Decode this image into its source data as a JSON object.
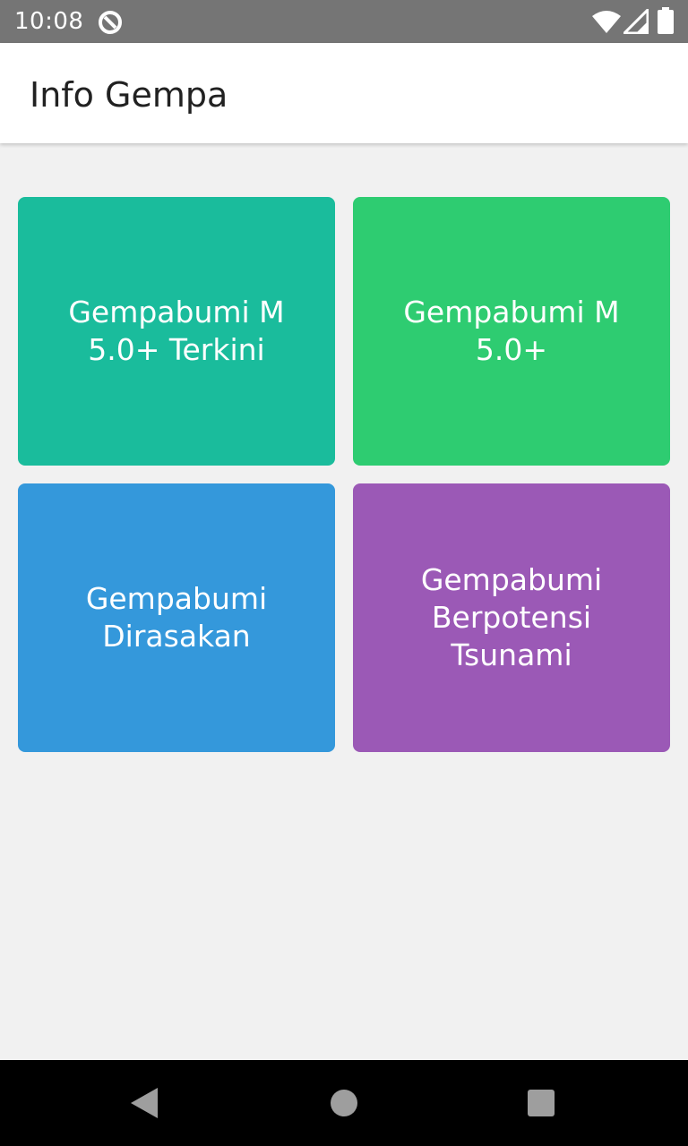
{
  "status_bar": {
    "time": "10:08",
    "background": "#757575",
    "icons": [
      "app-notification-icon",
      "wifi-icon",
      "cell-signal-icon",
      "battery-icon"
    ]
  },
  "app_bar": {
    "title": "Info Gempa"
  },
  "menu": {
    "tiles": [
      {
        "label_lines": [
          "Gempabumi M",
          "5.0+ Terkini"
        ],
        "color": "#1abc9c"
      },
      {
        "label_lines": [
          "Gempabumi M",
          "5.0+"
        ],
        "color": "#2ecc71"
      },
      {
        "label_lines": [
          "Gempabumi",
          "Dirasakan"
        ],
        "color": "#3498db"
      },
      {
        "label_lines": [
          "Gempabumi",
          "Berpotensi",
          "Tsunami"
        ],
        "color": "#9b59b6"
      }
    ]
  },
  "nav_bar": {
    "icons": [
      "back-icon",
      "home-icon",
      "recents-icon"
    ]
  }
}
